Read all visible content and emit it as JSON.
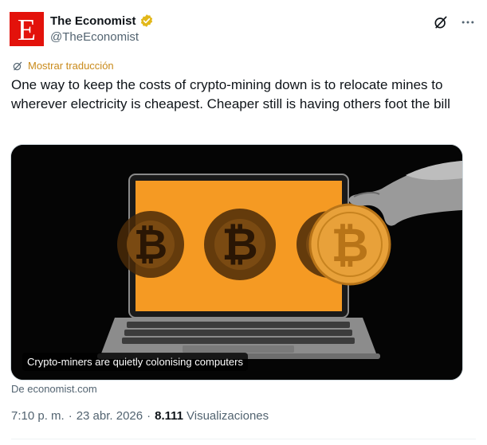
{
  "author": {
    "name": "The Economist",
    "handle": "@TheEconomist",
    "logo_letter": "E",
    "brand_color": "#e3120b",
    "verified_badge_color": "#e2b719"
  },
  "top_actions": {
    "grok_icon": "grok-icon",
    "more_icon": "more-icon"
  },
  "translate_label": "Mostrar traducción",
  "tweet_text": "One way to keep the costs of crypto-mining down is to relocate mines to wherever electricity is cheapest. Cheaper still is having others foot the bill",
  "media": {
    "caption": "Crypto-miners are quietly colonising computers",
    "screen_color": "#f59a23",
    "coin_color": "#e8a13a"
  },
  "source_label": "De economist.com",
  "meta": {
    "time": "7:10 p. m.",
    "separator": "·",
    "date": "23 abr. 2026",
    "views_count": "8.111",
    "views_label": "Visualizaciones"
  }
}
